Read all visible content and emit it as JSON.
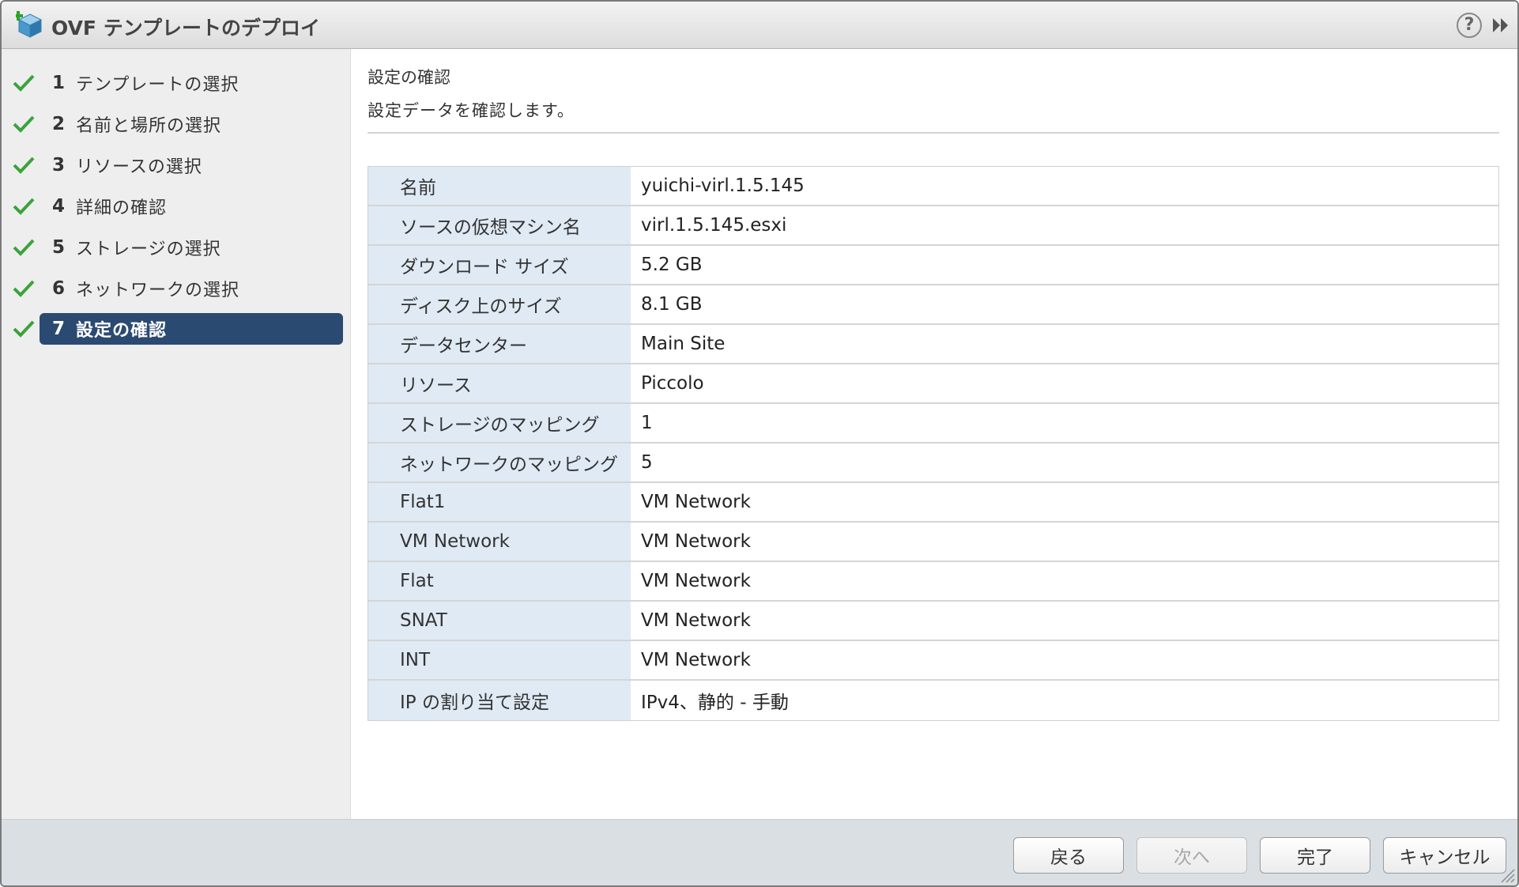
{
  "window": {
    "title": "OVF テンプレートのデプロイ",
    "help_glyph": "?"
  },
  "colors": {
    "accent": "#2b4a72",
    "check": "#3aa33a",
    "label_cell_bg": "#dfeaf4",
    "footer_bg": "#dadfe4"
  },
  "steps": [
    {
      "number": "1",
      "label": "テンプレートの選択",
      "completed": true,
      "active": false
    },
    {
      "number": "2",
      "label": "名前と場所の選択",
      "completed": true,
      "active": false
    },
    {
      "number": "3",
      "label": "リソースの選択",
      "completed": true,
      "active": false
    },
    {
      "number": "4",
      "label": "詳細の確認",
      "completed": true,
      "active": false
    },
    {
      "number": "5",
      "label": "ストレージの選択",
      "completed": true,
      "active": false
    },
    {
      "number": "6",
      "label": "ネットワークの選択",
      "completed": true,
      "active": false
    },
    {
      "number": "7",
      "label": "設定の確認",
      "completed": true,
      "active": true
    }
  ],
  "main": {
    "title": "設定の確認",
    "description": "設定データを確認します。"
  },
  "table_rows": [
    {
      "label": "名前",
      "value": "yuichi-virl.1.5.145",
      "expander": "none"
    },
    {
      "label": "ソースの仮想マシン名",
      "value": "virl.1.5.145.esxi",
      "expander": "none"
    },
    {
      "label": "ダウンロード サイズ",
      "value": "5.2 GB",
      "expander": "none"
    },
    {
      "label": "ディスク上のサイズ",
      "value": "8.1 GB",
      "expander": "none"
    },
    {
      "label": "データセンター",
      "value": "Main Site",
      "expander": "none"
    },
    {
      "label": "リソース",
      "value": "Piccolo",
      "expander": "none"
    },
    {
      "label": "ストレージのマッピング",
      "value": "1",
      "expander": "collapsed"
    },
    {
      "label": "ネットワークのマッピング",
      "value": "5",
      "expander": "expanded"
    },
    {
      "label": "Flat1",
      "value": "VM Network",
      "expander": "none"
    },
    {
      "label": "VM Network",
      "value": "VM Network",
      "expander": "none"
    },
    {
      "label": "Flat",
      "value": "VM Network",
      "expander": "none"
    },
    {
      "label": "SNAT",
      "value": "VM Network",
      "expander": "none"
    },
    {
      "label": "INT",
      "value": "VM Network",
      "expander": "none"
    },
    {
      "label": "IP の割り当て設定",
      "value": "IPv4、静的 - 手動",
      "expander": "collapsed"
    }
  ],
  "footer": {
    "back_label": "戻る",
    "next_label": "次へ",
    "finish_label": "完了",
    "cancel_label": "キャンセル"
  },
  "icons": {
    "window_icon": "ovf-deploy-icon",
    "help": "help-icon",
    "expand": "double-chevron-right-icon",
    "step_status": "check-icon",
    "row_collapsed": "triangle-right-icon",
    "row_expanded": "triangle-down-icon"
  }
}
